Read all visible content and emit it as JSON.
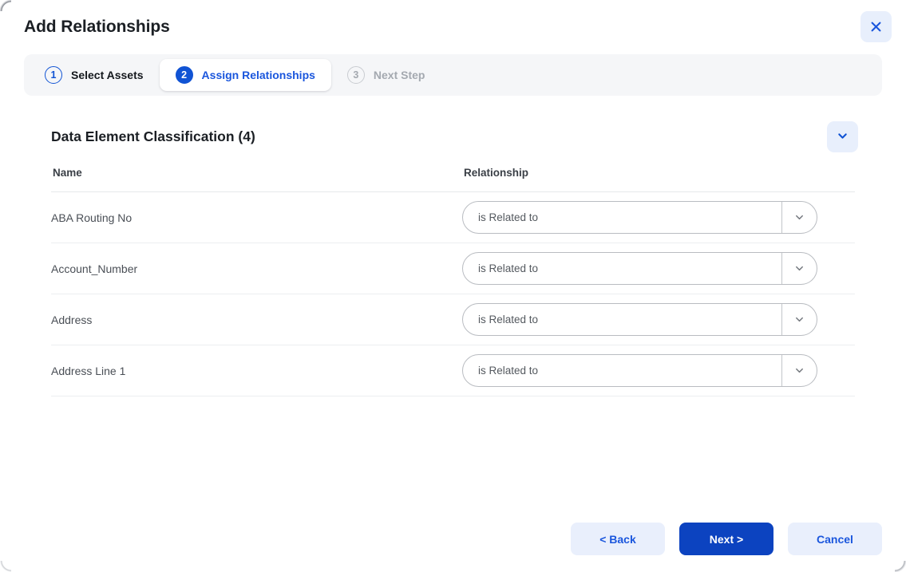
{
  "modal": {
    "title": "Add Relationships",
    "close_icon": "close-icon"
  },
  "stepper": {
    "steps": [
      {
        "num": "1",
        "label": "Select Assets",
        "state": "done"
      },
      {
        "num": "2",
        "label": "Assign Relationships",
        "state": "active"
      },
      {
        "num": "3",
        "label": "Next Step",
        "state": "todo"
      }
    ]
  },
  "section": {
    "title": "Data Element Classification (4)",
    "collapse_icon": "chevron-down-icon"
  },
  "table": {
    "columns": [
      "Name",
      "Relationship"
    ],
    "rows": [
      {
        "name": "ABA Routing No",
        "relationship": "is Related to"
      },
      {
        "name": "Account_Number",
        "relationship": "is Related to"
      },
      {
        "name": "Address",
        "relationship": "is Related to"
      },
      {
        "name": "Address Line 1",
        "relationship": "is Related to"
      }
    ]
  },
  "footer": {
    "back_label": "< Back",
    "next_label": "Next >",
    "cancel_label": "Cancel"
  },
  "colors": {
    "primary_blue": "#0c43c0",
    "link_blue": "#1a56dd",
    "light_blue_bg": "#e9effc",
    "stepper_bg": "#f5f6f8",
    "muted_text": "#a4a9b0"
  }
}
